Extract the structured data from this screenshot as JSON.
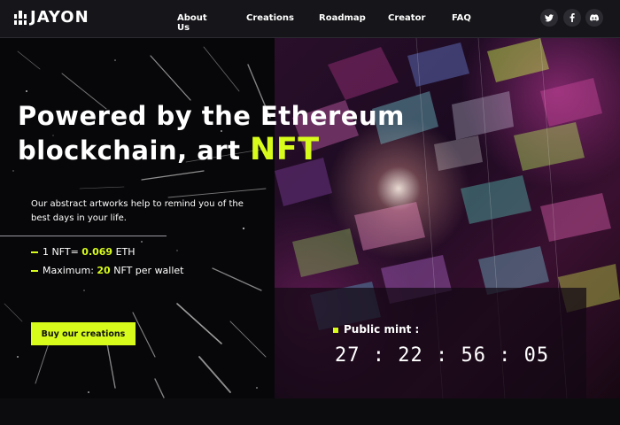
{
  "brand": {
    "name": "JAYON"
  },
  "nav": {
    "links": [
      "About Us",
      "Creations",
      "Roadmap",
      "Creator",
      "FAQ"
    ]
  },
  "social": [
    {
      "name": "twitter-icon",
      "glyph": "🐦"
    },
    {
      "name": "facebook-icon",
      "glyph": "f"
    },
    {
      "name": "discord-icon",
      "glyph": "◉"
    }
  ],
  "hero": {
    "headline_line1": "Powered by the Ethereum",
    "headline_line2": "blockchain, art ",
    "headline_highlight": "NFT",
    "description": "Our abstract artworks help to remind you of the best days in your life.",
    "stat1_prefix": "1 NFT= ",
    "stat1_value": "0.069",
    "stat1_suffix": " ETH",
    "stat2_prefix": "Maximum: ",
    "stat2_value": "20",
    "stat2_suffix": " NFT per wallet",
    "cta_label": "Buy our creations"
  },
  "mint": {
    "label": "Public mint :",
    "countdown": "27 : 22 : 56 : 05"
  },
  "colors": {
    "accent": "#d7fb1b",
    "nav_bg": "#16161a",
    "background": "#0b0b0e"
  }
}
